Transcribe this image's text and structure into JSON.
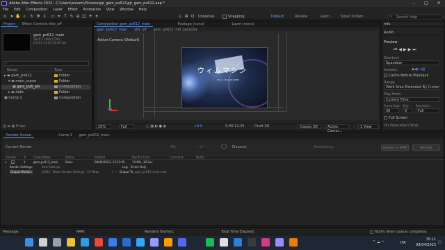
{
  "window": {
    "title": "Adobe After Effects 2023 - C:\\Users\\annam\\Pictures\\pjr_gam_pv612\\pjr_gam_pv612.aep *",
    "minimize": "–",
    "maximize": "□",
    "close": "✕"
  },
  "menu": [
    "File",
    "Edit",
    "Composition",
    "Layer",
    "Effect",
    "Animation",
    "View",
    "Window",
    "Help"
  ],
  "toolbar": {
    "snapping_label": "Snapping",
    "universal_label": "Universal"
  },
  "workspaces": [
    "Default",
    "Review",
    "Learn",
    "Small Screen"
  ],
  "search_placeholder": "Search Help",
  "project": {
    "tabs": [
      "Project",
      "Effect Controls title_aff"
    ],
    "comp_name": "gam_pv612_main",
    "comp_info_1": "1920 x 1080 (1.00)",
    "comp_info_2": "Δ 0;01:11:23, 60.00 fps",
    "search_placeholder": "",
    "col_name": "Name",
    "col_type": "Type",
    "items": [
      {
        "name": "gam_pv612",
        "type": "Folder",
        "color": "#d4b43a"
      },
      {
        "name": "main_scene",
        "type": "Folder",
        "color": "#d4b43a"
      },
      {
        "name": "gam_pv6_ain",
        "type": "Composition",
        "color": "#9a9a9a"
      },
      {
        "name": "data",
        "type": "Folder",
        "color": "#d4b43a"
      },
      {
        "name": "Comp 1",
        "type": "Composition",
        "color": "#9a9a9a"
      }
    ],
    "bpc": "8 bpc"
  },
  "viewer": {
    "tabs": [
      "Composition gam_pv612_main",
      "Footage (none)",
      "Layer (none)"
    ],
    "subtabs": [
      "gam_pv612_main",
      "s01_off",
      "gam_pv612_m0_para01a"
    ],
    "camera_label": "Active Camera (Default)",
    "image_title": "ウィムマシン",
    "image_subtitle": "15 1 1 (34) (LE-4IMP)",
    "zoom": "25%",
    "resolution": "Full",
    "timecode": "0;00:12;39",
    "renderer": "Draft 3D",
    "renderer2": "Classic 3D",
    "camera_menu": "Active Camer...",
    "views": "1 View",
    "exposure": "+0.0"
  },
  "right": {
    "tabs": [
      "Info",
      "Audio",
      "Preview"
    ],
    "shortcut_label": "Shortcut",
    "shortcut_value": "Spacebar",
    "include_label": "Include:",
    "cache_label": "Cache Before Playback",
    "range_label": "Range",
    "range_value": "Work Area Extended By Current...",
    "play_from_label": "Play From",
    "play_from_value": "Current Time",
    "frame_rate_label": "Frame Rate",
    "skip_label": "Skip",
    "resolution_label": "Resolution",
    "frame_rate_value": "30",
    "skip_value": "0",
    "resolution_value": "Full",
    "fullscreen_label": "Full Screen",
    "stop_label": "On (Spacebar) Stop:"
  },
  "render_queue": {
    "tabs": [
      "Render Queue",
      "Comp 1",
      "gam_pv612_main"
    ],
    "current_render_label": "Current Render",
    "progress": "0%",
    "eta": "-- d' --",
    "elapsed_label": "Elapsed:",
    "remaining_label": "Remaining:",
    "queue_ame_button": "Queue in AME",
    "render_button": "Render",
    "columns": [
      "Render",
      "#",
      "Comp Name",
      "Status",
      "Started",
      "Render Time",
      "Comment",
      "Notify"
    ],
    "row": {
      "index": "1",
      "comp": "gam_pv612_main",
      "status": "Done",
      "started": "08/04/2023, 13:21:05",
      "render_time": "14 Min, 30 Sec"
    },
    "render_settings_label": "Render Settings:",
    "render_settings_value": "Best Settings",
    "log_label": "Log:",
    "log_value": "Errors Only",
    "output_module_label": "Output Module:",
    "output_module_value": "H.264 - Match Render Settings - 15 Mbps",
    "output_to_label": "Output To:",
    "output_to_value": "gam_pv612_main.mp4"
  },
  "status": {
    "message_label": "Message:",
    "ram_label": "RAM:",
    "renders_started_label": "Renders Started:",
    "total_time_label": "Total Time Elapsed:",
    "notify_label": "Notify when queue completes"
  },
  "taskbar": {
    "lang": "ITA",
    "time": "15:11",
    "date": "08/04/2023",
    "apps": [
      {
        "name": "start-icon",
        "color": "#3b8ee8"
      },
      {
        "name": "search-icon",
        "color": "#cfcfcf"
      },
      {
        "name": "taskview-icon",
        "color": "#9aa0aa"
      },
      {
        "name": "explorer-icon",
        "color": "#e8c23b"
      },
      {
        "name": "edge-icon",
        "color": "#2e9be6"
      },
      {
        "name": "chrome-icon",
        "color": "#e24a3b"
      },
      {
        "name": "store-icon",
        "color": "#3a7be8"
      },
      {
        "name": "mail-icon",
        "color": "#2a6ad1"
      },
      {
        "name": "photoshop-icon",
        "color": "#31a8ff"
      },
      {
        "name": "premiere-icon",
        "color": "#9999ff"
      },
      {
        "name": "illustrator-icon",
        "color": "#ff9a00"
      },
      {
        "name": "discord-icon",
        "color": "#5865f2"
      },
      {
        "name": "steam-icon",
        "color": "#1b2838"
      },
      {
        "name": "spotify-icon",
        "color": "#1db954"
      },
      {
        "name": "unity-icon",
        "color": "#e0e0e0"
      },
      {
        "name": "vscode-icon",
        "color": "#2a7fd6"
      },
      {
        "name": "obs-icon",
        "color": "#3a3a3a"
      },
      {
        "name": "media-icon",
        "color": "#d23a8a"
      },
      {
        "name": "aftereffects-icon",
        "color": "#9a8cff"
      },
      {
        "name": "blender-icon",
        "color": "#e87d0d"
      }
    ]
  }
}
